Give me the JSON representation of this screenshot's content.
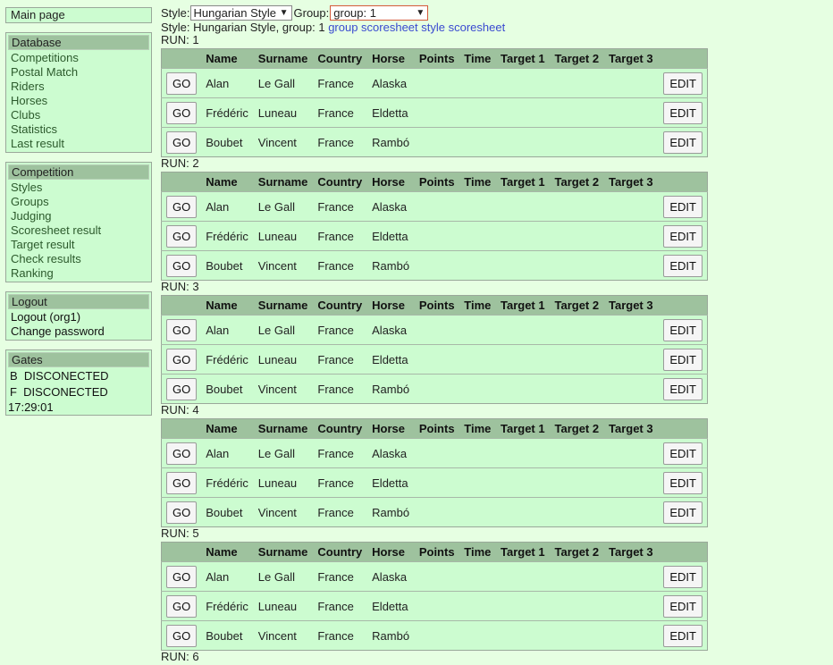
{
  "sidebar": {
    "main_page": "Main page",
    "database": {
      "title": "Database",
      "items": [
        "Competitions",
        "Postal Match",
        "Riders",
        "Horses",
        "Clubs",
        "Statistics",
        "Last result"
      ]
    },
    "competition": {
      "title": "Competition",
      "items": [
        "Styles",
        "Groups",
        "Judging",
        "Scoresheet result",
        "Target result",
        "Check results",
        "Ranking"
      ]
    },
    "logout": {
      "title": "Logout",
      "items": [
        "Logout (org1)",
        "Change password"
      ]
    },
    "gates": {
      "title": "Gates",
      "rows": [
        "B  DISCONECTED",
        "F  DISCONECTED"
      ],
      "time": "17:29:01"
    }
  },
  "controls": {
    "style_label": "Style:",
    "style_value": "Hungarian Style",
    "group_label": "Group:",
    "group_value": "group: 1",
    "arrow": "▼"
  },
  "info": {
    "text": "Style: Hungarian Style, group: 1",
    "link1": "group scoresheet",
    "link2": "style scoresheet"
  },
  "table": {
    "headers": [
      "",
      "Name",
      "Surname",
      "Country",
      "Horse",
      "Points",
      "Time",
      "Target 1",
      "Target 2",
      "Target 3",
      ""
    ],
    "go_label": "GO",
    "edit_label": "EDIT",
    "rows": [
      {
        "name": "Alan",
        "surname": "Le Gall",
        "country": "France",
        "horse": "Alaska"
      },
      {
        "name": "Frédéric",
        "surname": "Luneau",
        "country": "France",
        "horse": "Eldetta"
      },
      {
        "name": "Boubet",
        "surname": "Vincent",
        "country": "France",
        "horse": "Rambó"
      }
    ]
  },
  "runs": [
    "RUN: 1",
    "RUN: 2",
    "RUN: 3",
    "RUN: 4",
    "RUN: 5",
    "RUN: 6"
  ]
}
